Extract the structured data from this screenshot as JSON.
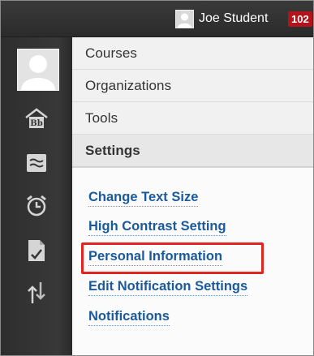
{
  "header": {
    "user_name": "Joe Student",
    "notification_count": "102"
  },
  "menu": {
    "items": [
      {
        "label": "Courses"
      },
      {
        "label": "Organizations"
      },
      {
        "label": "Tools"
      },
      {
        "label": "Settings"
      }
    ],
    "active": "Settings"
  },
  "settings_links": [
    {
      "label": "Change Text Size"
    },
    {
      "label": "High Contrast Setting"
    },
    {
      "label": "Personal Information"
    },
    {
      "label": "Edit Notification Settings"
    },
    {
      "label": "Notifications"
    }
  ],
  "highlighted_link": "Personal Information",
  "rail_icons": [
    "avatar-icon",
    "bb-home-icon",
    "stream-icon",
    "alarm-clock-icon",
    "grades-icon",
    "sort-arrows-icon"
  ],
  "colors": {
    "topbar": "#2b2b2b",
    "badge": "#b3131b",
    "link": "#1a5a9c",
    "highlight": "#e2261f"
  }
}
